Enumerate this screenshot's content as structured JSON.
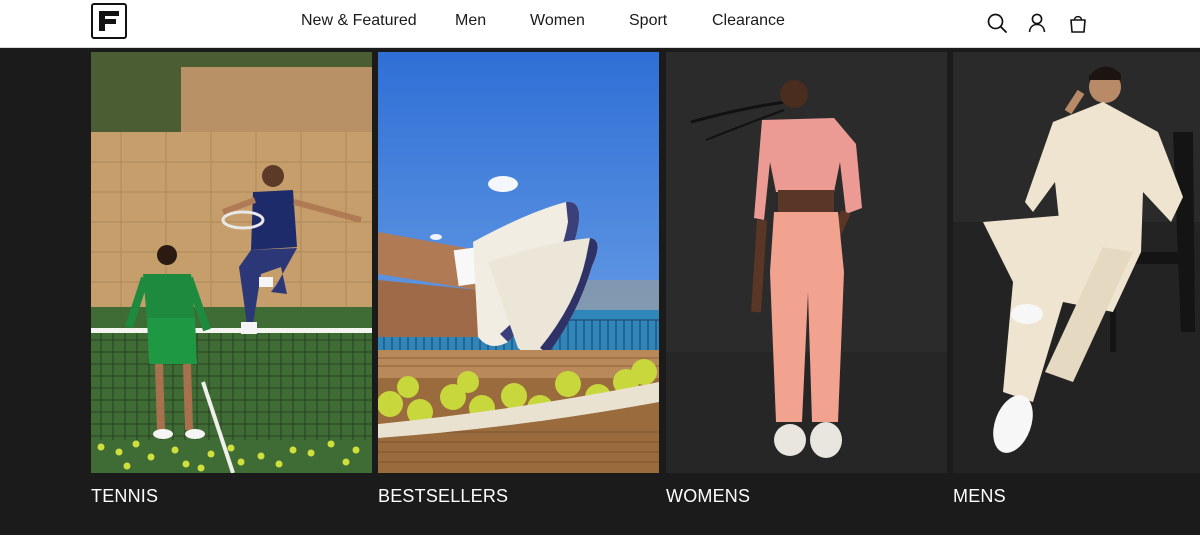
{
  "brand": {
    "logo_text": "F"
  },
  "nav": {
    "items": [
      {
        "label": "New & Featured"
      },
      {
        "label": "Men"
      },
      {
        "label": "Women"
      },
      {
        "label": "Sport"
      },
      {
        "label": "Clearance"
      }
    ]
  },
  "header_icons": [
    "search-icon",
    "account-icon",
    "bag-icon"
  ],
  "tiles": [
    {
      "label": "TENNIS",
      "image": "tennis-players-at-net-image"
    },
    {
      "label": "BESTSELLERS",
      "image": "sneakers-on-tennis-ball-basket-image"
    },
    {
      "label": "WOMENS",
      "image": "woman-in-pink-sweats-image"
    },
    {
      "label": "MENS",
      "image": "man-in-cream-sweatsuit-image"
    }
  ],
  "colors": {
    "header_bg": "#ffffff",
    "page_bg": "#1b1b1b",
    "label_text": "#ffffff"
  }
}
